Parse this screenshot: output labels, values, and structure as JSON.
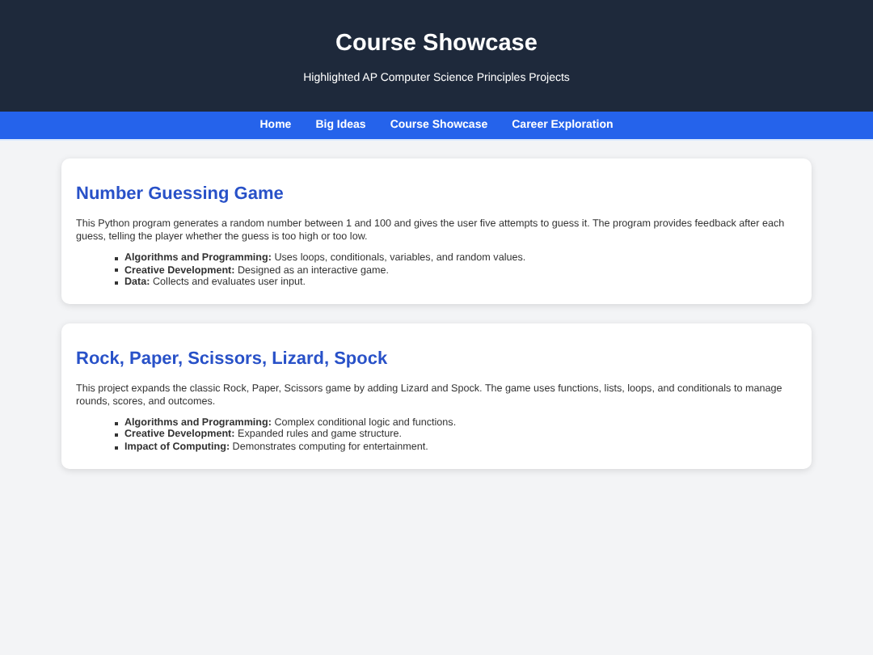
{
  "header": {
    "title": "Course Showcase",
    "subtitle": "Highlighted AP Computer Science Principles Projects"
  },
  "nav": [
    "Home",
    "Big Ideas",
    "Course Showcase",
    "Career Exploration"
  ],
  "projects": [
    {
      "title": "Number Guessing Game",
      "description": "This Python program generates a random number between 1 and 100 and gives the user five attempts to guess it. The program provides feedback after each guess, telling the player whether the guess is too high or too low.",
      "points": [
        "**Algorithms and Programming:** Uses loops, conditionals, variables, and random values.",
        "**Creative Development:** Designed as an interactive game.",
        "**Data:** Collects and evaluates user input."
      ]
    },
    {
      "title": "Rock, Paper, Scissors, Lizard, Spock",
      "description": "This project expands the classic Rock, Paper, Scissors game by adding Lizard and Spock. The game uses functions, lists, loops, and conditionals to manage rounds, scores, and outcomes.",
      "points": [
        "**Algorithms and Programming:** Complex conditional logic and functions.",
        "**Creative Development:** Expanded rules and game structure.",
        "**Impact of Computing:** Demonstrates computing for entertainment."
      ]
    }
  ]
}
